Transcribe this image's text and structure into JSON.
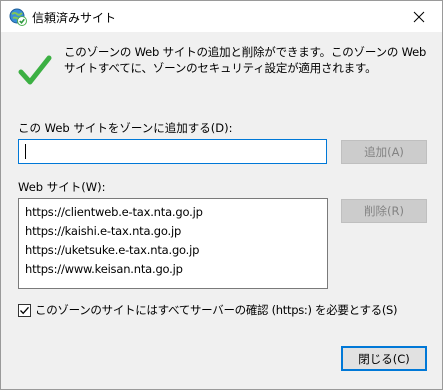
{
  "window": {
    "title": "信頼済みサイト",
    "close_glyph": "×"
  },
  "info": {
    "description": "このゾーンの Web サイトの追加と削除ができます。このゾーンの Web サイトすべてに、ゾーンのセキュリティ設定が適用されます。"
  },
  "add_section": {
    "label": "この Web サイトをゾーンに追加する(D):",
    "input_value": "",
    "add_button": "追加(A)"
  },
  "sites_section": {
    "label": "Web サイト(W):",
    "sites": [
      "https://clientweb.e-tax.nta.go.jp",
      "https://kaishi.e-tax.nta.go.jp",
      "https://uketsuke.e-tax.nta.go.jp",
      "https://www.keisan.nta.go.jp"
    ],
    "remove_button": "削除(R)"
  },
  "https_requirement": {
    "checked": true,
    "label": "このゾーンのサイトにはすべてサーバーの確認 (https:) を必要とする(S)"
  },
  "footer": {
    "close_button": "閉じる(C)"
  },
  "colors": {
    "accent": "#0078d7",
    "check_green": "#3cb043",
    "dialog_bg": "#f0f0f0"
  },
  "icons": {
    "title_icon": "globe-check-icon",
    "info_icon": "green-checkmark-icon",
    "close_icon": "close-icon"
  }
}
